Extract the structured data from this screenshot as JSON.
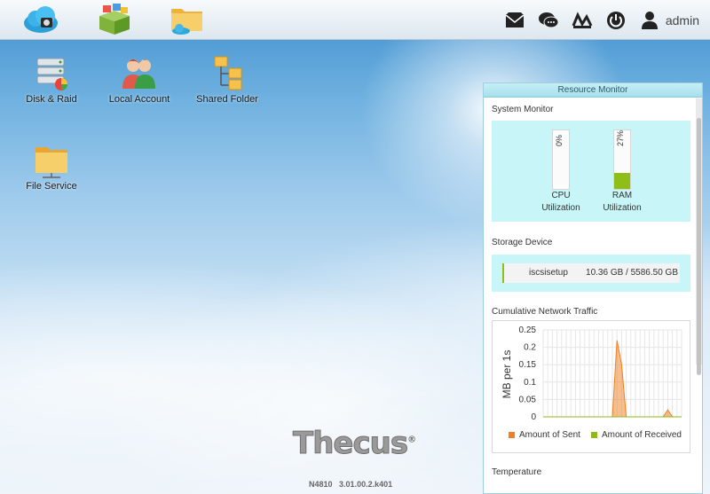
{
  "taskbar": {
    "apps": [
      {
        "name": "cloud-app",
        "icon": "cloud-icon"
      },
      {
        "name": "app-center",
        "icon": "app-center-icon"
      },
      {
        "name": "file-manager",
        "icon": "folder-cloud-icon"
      }
    ],
    "right_icons": [
      "mail-icon",
      "chat-icon",
      "network-icon",
      "power-icon",
      "user-icon"
    ],
    "user_label": "admin"
  },
  "desktop": {
    "icons": [
      {
        "label": "Disk & Raid",
        "icon": "disk-raid-icon"
      },
      {
        "label": "Local Account",
        "icon": "local-account-icon"
      },
      {
        "label": "Shared Folder",
        "icon": "shared-folder-icon"
      },
      {
        "label": "File Service",
        "icon": "file-service-icon"
      }
    ]
  },
  "brand": {
    "name": "Thecus",
    "mark": "®",
    "model": "N4810",
    "version": "3.01.00.2.k401"
  },
  "resource_monitor": {
    "title": "Resource Monitor",
    "system_monitor": {
      "title": "System Monitor",
      "cpu": {
        "percent_label": "0%",
        "value": 0,
        "label_line1": "CPU",
        "label_line2": "Utilization"
      },
      "ram": {
        "percent_label": "27%",
        "value": 27,
        "label_line1": "RAM",
        "label_line2": "Utilization"
      }
    },
    "storage": {
      "title": "Storage Device",
      "devices": [
        {
          "name": "iscsisetup",
          "usage": "10.36 GB / 5586.50 GB"
        }
      ]
    },
    "network": {
      "title": "Cumulative Network Traffic",
      "ylabel": "MB per 1s",
      "legend_sent": "Amount of Sent",
      "legend_received": "Amount of Received",
      "color_sent": "#f08020",
      "color_received": "#8fb81a"
    },
    "temperature": {
      "title": "Temperature"
    }
  },
  "chart_data": {
    "type": "area",
    "ylabel": "MB per 1s",
    "ylim": [
      0,
      0.25
    ],
    "yticks": [
      "0.25",
      "0.2",
      "0.15",
      "0.1",
      "0.05",
      "0"
    ],
    "grid": true,
    "legend_position": "bottom",
    "series": [
      {
        "name": "Amount of Sent",
        "x": [
          0,
          28,
          30,
          32,
          34,
          36,
          38,
          52,
          54,
          56,
          60
        ],
        "values": [
          0,
          0,
          0.0,
          0.22,
          0.15,
          0.0,
          0,
          0,
          0.02,
          0,
          0
        ]
      },
      {
        "name": "Amount of Received",
        "x": [
          0,
          60
        ],
        "values": [
          0,
          0
        ]
      }
    ]
  }
}
